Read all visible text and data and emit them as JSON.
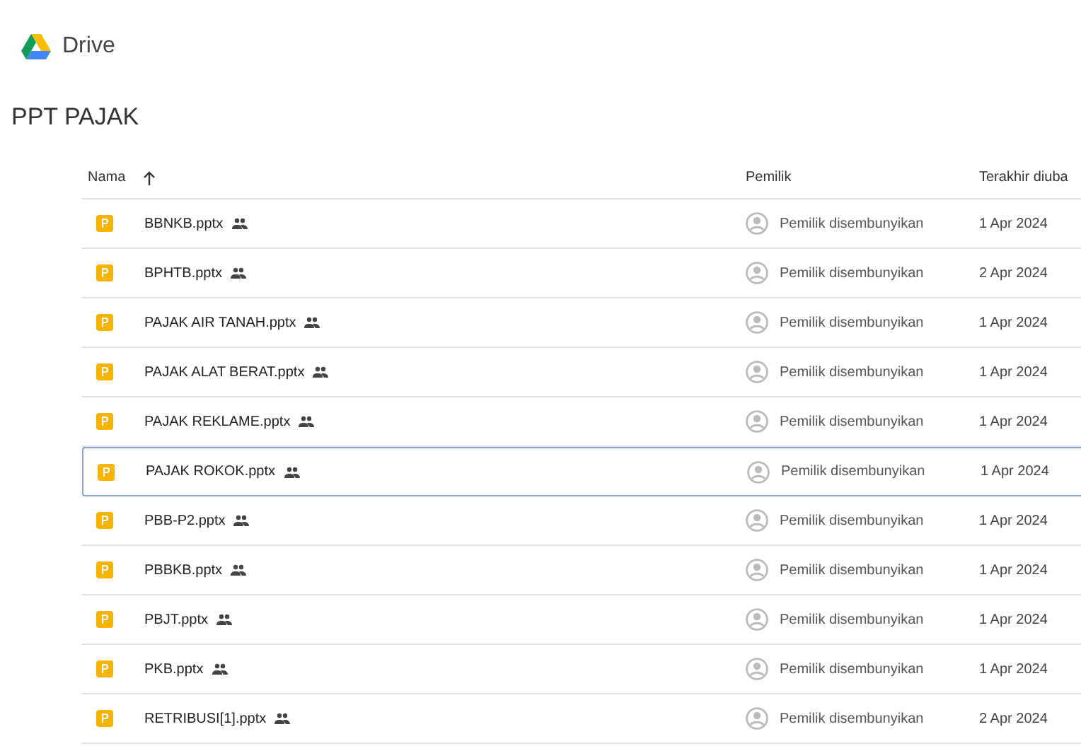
{
  "app": {
    "name": "Drive"
  },
  "folder": {
    "title": "PPT PAJAK"
  },
  "table": {
    "columns": [
      {
        "label": "Nama",
        "sorted": true,
        "ascending": true
      },
      {
        "label": "Pemilik"
      },
      {
        "label": "Terakhir diuba"
      }
    ],
    "rows": [
      {
        "name": "BBNKB.pptx",
        "shared": true,
        "owner": "Pemilik disembunyikan",
        "modified": "1 Apr 2024",
        "selected": false
      },
      {
        "name": "BPHTB.pptx",
        "shared": true,
        "owner": "Pemilik disembunyikan",
        "modified": "2 Apr 2024",
        "selected": false
      },
      {
        "name": "PAJAK AIR TANAH.pptx",
        "shared": true,
        "owner": "Pemilik disembunyikan",
        "modified": "1 Apr 2024",
        "selected": false
      },
      {
        "name": "PAJAK ALAT BERAT.pptx",
        "shared": true,
        "owner": "Pemilik disembunyikan",
        "modified": "1 Apr 2024",
        "selected": false
      },
      {
        "name": "PAJAK REKLAME.pptx",
        "shared": true,
        "owner": "Pemilik disembunyikan",
        "modified": "1 Apr 2024",
        "selected": false
      },
      {
        "name": "PAJAK ROKOK.pptx",
        "shared": true,
        "owner": "Pemilik disembunyikan",
        "modified": "1 Apr 2024",
        "selected": true
      },
      {
        "name": "PBB-P2.pptx",
        "shared": true,
        "owner": "Pemilik disembunyikan",
        "modified": "1 Apr 2024",
        "selected": false
      },
      {
        "name": "PBBKB.pptx",
        "shared": true,
        "owner": "Pemilik disembunyikan",
        "modified": "1 Apr 2024",
        "selected": false
      },
      {
        "name": "PBJT.pptx",
        "shared": true,
        "owner": "Pemilik disembunyikan",
        "modified": "1 Apr 2024",
        "selected": false
      },
      {
        "name": "PKB.pptx",
        "shared": true,
        "owner": "Pemilik disembunyikan",
        "modified": "1 Apr 2024",
        "selected": false
      },
      {
        "name": "RETRIBUSI[1].pptx",
        "shared": true,
        "owner": "Pemilik disembunyikan",
        "modified": "2 Apr 2024",
        "selected": false
      }
    ]
  }
}
